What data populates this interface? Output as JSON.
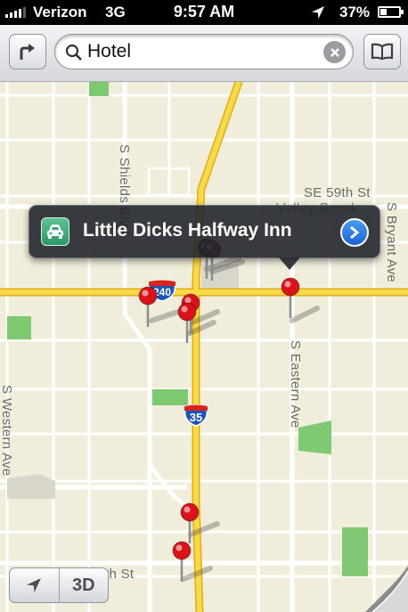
{
  "status_bar": {
    "carrier": "Verizon",
    "network": "3G",
    "time": "9:57 AM",
    "battery_percent": "37%",
    "battery_level": 0.37,
    "location_icon": "location-arrow-icon"
  },
  "search_bar": {
    "directions_icon": "directions-arrow-icon",
    "search_icon": "magnifier-icon",
    "query": "Hotel",
    "clear_icon": "clear-x-icon",
    "bookmarks_icon": "bookmarks-book-icon"
  },
  "map": {
    "streets": {
      "s_shields_blvd": "S Shields Blvd",
      "se_59th_st": "SE 59th St",
      "valley_brook": "Valley Brook",
      "s_bryant_ave": "S Bryant Ave",
      "s_eastern_ave": "S Eastern Ave",
      "s_western_ave": "S Western Ave",
      "th_st": "th St"
    },
    "shields": {
      "i240": "240",
      "i35": "35"
    },
    "colors": {
      "land": "#f2eedc",
      "road": "#ffffff",
      "highway": "#f6d23a",
      "park": "#7fc973",
      "pin": "#d8131a"
    }
  },
  "callout": {
    "category_icon": "car-icon",
    "title": "Little Dicks Halfway Inn",
    "disclosure_icon": "chevron-right-icon"
  },
  "controls": {
    "tracking_icon": "location-arrow-icon",
    "three_d_label": "3D",
    "page_curl_icon": "page-curl-icon"
  }
}
